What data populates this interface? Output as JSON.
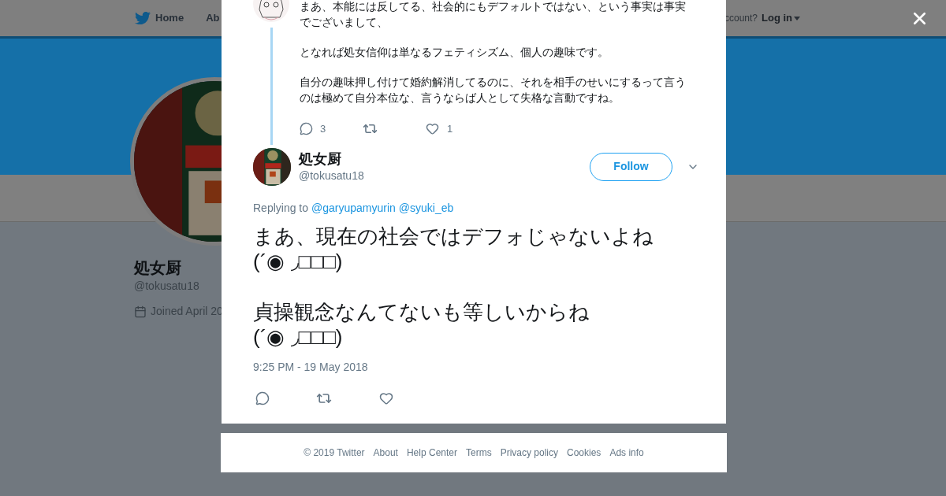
{
  "nav": {
    "items": [
      {
        "label": "Home",
        "kind": "logo"
      },
      {
        "label": "Ab",
        "kind": "plain"
      }
    ],
    "account_prompt": "ccount?",
    "login": "Log in"
  },
  "profile": {
    "name": "処女厨",
    "handle": "@tokusatu18",
    "joined": "Joined April 20"
  },
  "modal": {
    "parent_tweet": {
      "paragraphs": [
        "まあ、本能には反してる、社会的にもデフォルトではない、という事実は事実でございまして、",
        "となれば処女信仰は単なるフェティシズム、個人の趣味です。",
        "自分の趣味押し付けて婚約解消してるのに、それを相手のせいにするって言うのは極めて自分本位な、言うならば人として失格な言動ですね。"
      ],
      "replies": "3",
      "likes": "1"
    },
    "tweet": {
      "name": "処女厨",
      "handle": "@tokusatu18",
      "follow": "Follow",
      "replying_label": "Replying to",
      "mentions": [
        "@garyupamyurin",
        "@syuki_eb"
      ],
      "paragraphs": [
        "まあ、現在の社会ではデフォじゃないよね\n(´◉ ◞□□□)",
        "貞操観念なんてないも等しいからね\n(´◉ ◞□□□)"
      ],
      "timestamp": "9:25 PM - 19 May 2018"
    }
  },
  "footer": {
    "links": [
      "© 2019 Twitter",
      "About",
      "Help Center",
      "Terms",
      "Privacy policy",
      "Cookies",
      "Ads info"
    ]
  }
}
